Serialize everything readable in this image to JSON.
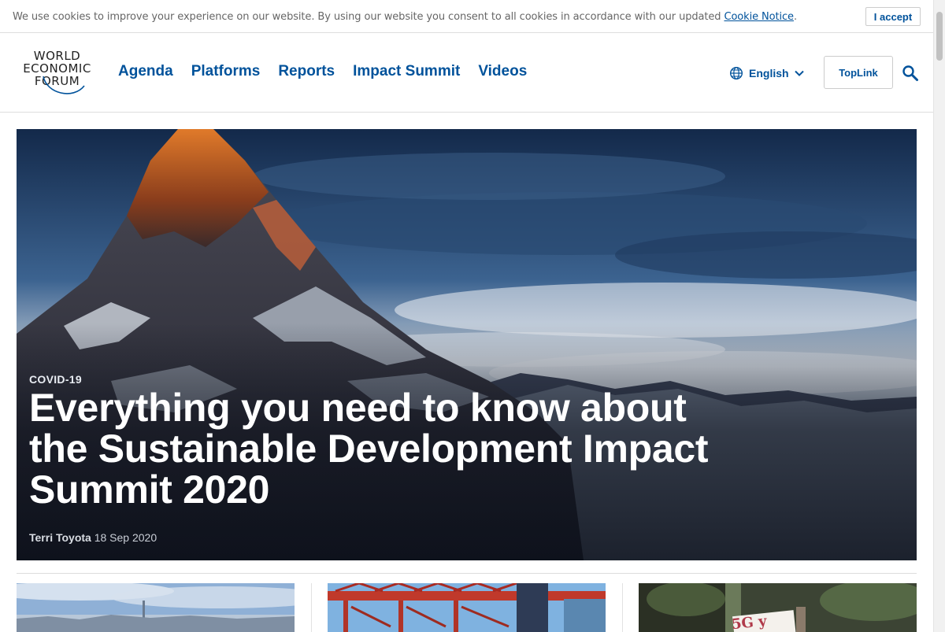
{
  "cookie": {
    "text": "We use cookies to improve your experience on our website. By using our website you consent to all cookies in accordance with our updated ",
    "link": "Cookie Notice",
    "trail": ".",
    "accept_label": "I accept"
  },
  "logo": {
    "line1": "WORLD",
    "line2": "ECONOMIC",
    "line3": "FORUM"
  },
  "nav": {
    "items": [
      "Agenda",
      "Platforms",
      "Reports",
      "Impact Summit",
      "Videos"
    ]
  },
  "header": {
    "language": "English",
    "toplink_label": "TopLink"
  },
  "hero": {
    "tag": "COVID-19",
    "title": "Everything you need to know about the Sustainable Development Impact Summit 2020",
    "author": "Terri Toyota",
    "date": "18 Sep 2020"
  },
  "cards": [
    {
      "image": "city-skyline-photo"
    },
    {
      "image": "port-cranes-photo"
    },
    {
      "image": "protest-sign-photo",
      "sign_text": "5G y"
    }
  ],
  "colors": {
    "brand_blue": "#00529b",
    "divider": "#dddddd"
  },
  "icons": {
    "language": "globe-icon",
    "language_dropdown": "chevron-down-icon",
    "search": "search-icon"
  }
}
